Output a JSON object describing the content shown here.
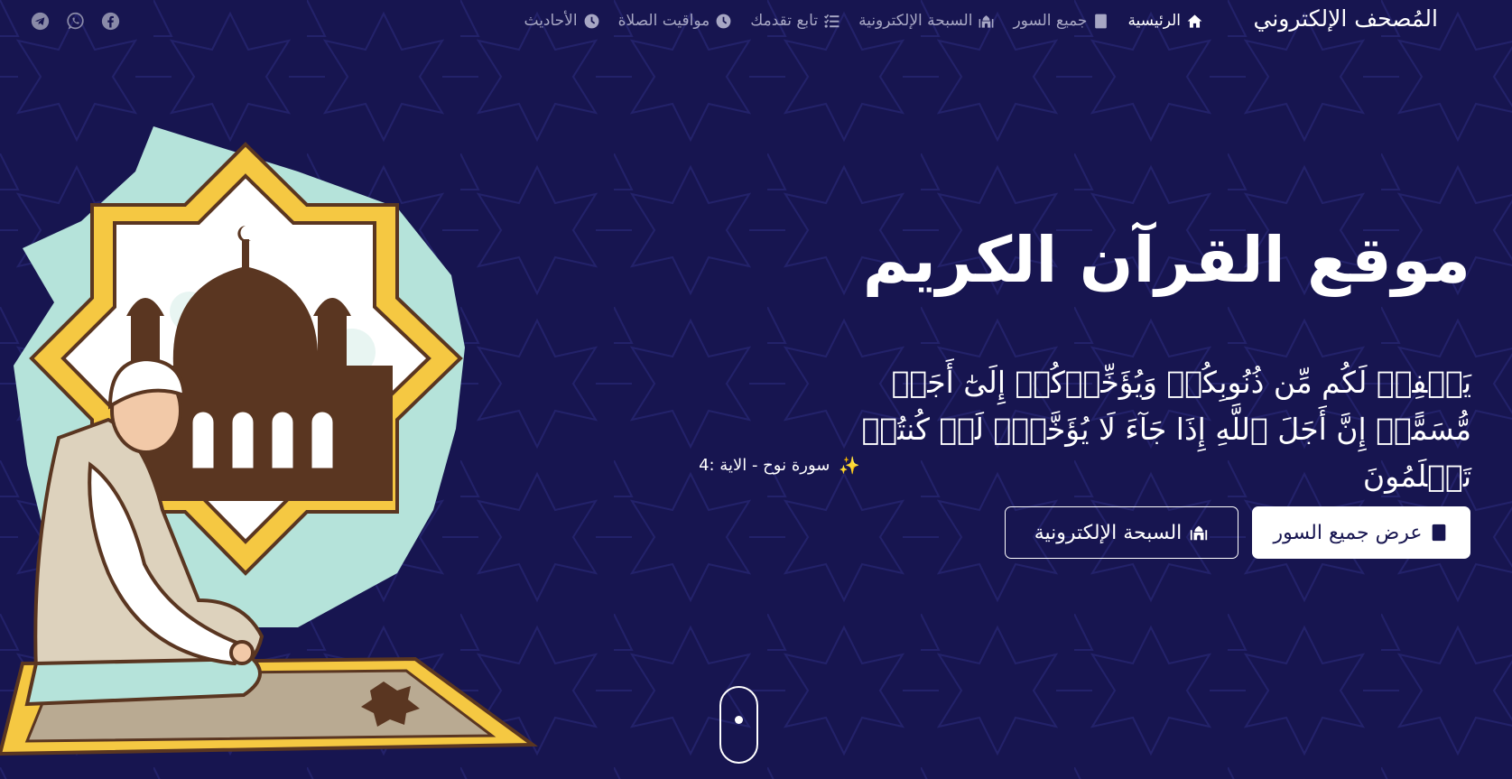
{
  "brand": "المُصحف الإلكتروني",
  "nav": {
    "items": [
      {
        "label": "الرئيسية",
        "icon": "home-icon",
        "active": true
      },
      {
        "label": "جميع السور",
        "icon": "quran-icon",
        "active": false
      },
      {
        "label": "السبحة الإلكترونية",
        "icon": "mosque-icon",
        "active": false
      },
      {
        "label": "تابع تقدمك",
        "icon": "list-check-icon",
        "active": false
      },
      {
        "label": "مواقيت الصلاة",
        "icon": "clock-icon",
        "active": false
      },
      {
        "label": "الأحاديث",
        "icon": "clock-icon",
        "active": false
      }
    ]
  },
  "social": [
    "facebook-icon",
    "whatsapp-icon",
    "telegram-icon"
  ],
  "hero": {
    "title": "موقع القرآن الكريم",
    "verse": "يَغۡفِرۡ لَكُم مِّن ذُنُوبِكُمۡ وَيُؤَخِّرۡكُمۡ إِلَىٰٓ أَجَلٖ مُّسَمًّىۚ إِنَّ أَجَلَ ٱللَّهِ إِذَا جَآءَ لَا يُؤَخَّرُۖ لَوۡ كُنتُمۡ تَعۡلَمُونَ",
    "reference": "سورة نوح - الاية :4",
    "reference_icon": "sparkles-icon",
    "primary_button": "عرض جميع السور",
    "secondary_button": "السبحة الإلكترونية"
  },
  "colors": {
    "background": "#171550",
    "nav_inactive": "#a7a7c4",
    "accent_gold": "#f5c842",
    "mint": "#b5e3da",
    "mosque_brown": "#5a3621"
  }
}
